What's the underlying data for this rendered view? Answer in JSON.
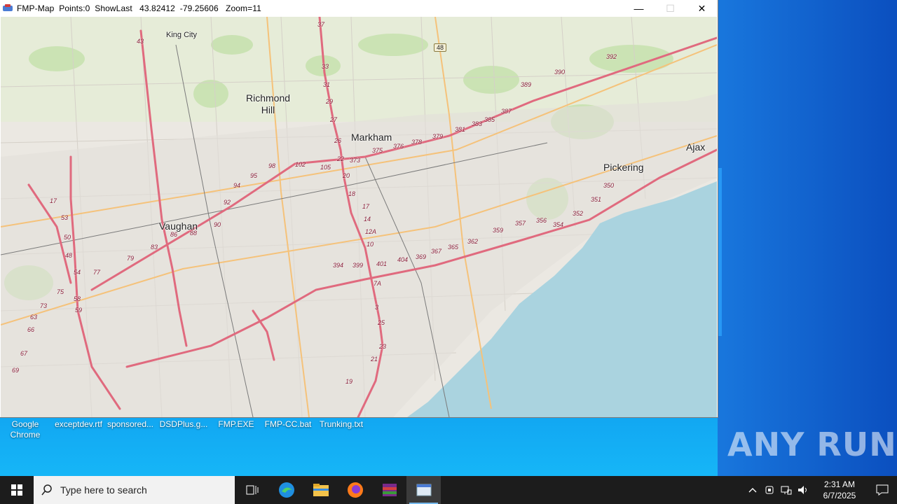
{
  "window": {
    "title": "FMP-Map  Points:0  ShowLast   43.82412  -79.25606   Zoom=11",
    "minimize": "—",
    "maximize": "☐",
    "close": "✕"
  },
  "map": {
    "places": [
      {
        "name": "King City"
      },
      {
        "name": "Richmond\nHill"
      },
      {
        "name": "Markham"
      },
      {
        "name": "Vaughan"
      },
      {
        "name": "Pickering"
      },
      {
        "name": "Ajax"
      }
    ],
    "shield": "48",
    "highway_numbers": [
      "37",
      "43",
      "33",
      "31",
      "29",
      "27",
      "26",
      "22",
      "20",
      "18",
      "17",
      "14",
      "12A",
      "10",
      "7A",
      "3",
      "25",
      "23",
      "21",
      "19",
      "17",
      "53",
      "50",
      "48",
      "54",
      "58",
      "59",
      "63",
      "66",
      "67",
      "69",
      "73",
      "75",
      "77",
      "79",
      "83",
      "86",
      "88",
      "90",
      "92",
      "94",
      "95",
      "98",
      "102",
      "105",
      "373",
      "375",
      "376",
      "378",
      "379",
      "381",
      "383",
      "385",
      "387",
      "389",
      "390",
      "392",
      "394",
      "399",
      "401",
      "404",
      "369",
      "367",
      "365",
      "362",
      "359",
      "357",
      "356",
      "354",
      "352",
      "351",
      "350"
    ]
  },
  "desktop": {
    "icons": [
      {
        "label": "Google\nChrome"
      },
      {
        "label": "exceptdev.rtf"
      },
      {
        "label": "sponsored..."
      },
      {
        "label": "DSDPlus.g..."
      },
      {
        "label": "FMP.EXE"
      },
      {
        "label": "FMP-CC.bat"
      },
      {
        "label": "Trunking.txt"
      }
    ],
    "watermark": "ANY RUN"
  },
  "taskbar": {
    "search_placeholder": "Type here to search",
    "time": "2:31 AM",
    "date": "6/7/2025"
  }
}
